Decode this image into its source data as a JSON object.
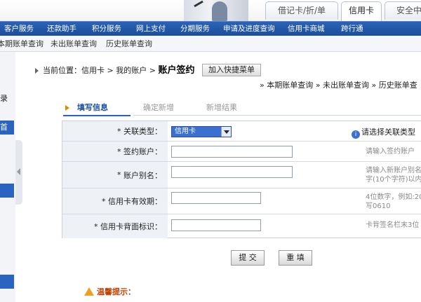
{
  "header": {
    "tabs": [
      "借记卡/折/单",
      "信用卡",
      "安全中"
    ]
  },
  "main_nav": [
    "客户服务",
    "还款助手",
    "积分服务",
    "网上支付",
    "分期服务",
    "申请及进度查询",
    "信用卡商城",
    "跨行通"
  ],
  "sub_nav": [
    "本期账单查询",
    "未出账单查询",
    "历史账单查询"
  ],
  "sidebar": {
    "items": [
      "录",
      "首"
    ]
  },
  "breadcrumb": {
    "prefix": "当前位置：",
    "path": [
      "信用卡",
      "我的账户"
    ],
    "current": "账户签约",
    "quick_button": "加入快捷菜单"
  },
  "bill_links": [
    "本期账单查询",
    "未出账单查询",
    "历史账单查"
  ],
  "steps": [
    "填写信息",
    "确定新增",
    "新增结果"
  ],
  "form": {
    "rows": [
      {
        "label": "关联类型：",
        "value": "信用卡",
        "hint": "请选择关联类型"
      },
      {
        "label": "签约账户：",
        "value": "",
        "hint": "请输入签约账户"
      },
      {
        "label": "账户别名：",
        "value": "",
        "hint": "请输入新账户别名",
        "hint2": "字(10个字符)以内"
      },
      {
        "label": "信用卡有效期：",
        "value": "",
        "hint": "4位数字，例如:20",
        "hint2": "写0610"
      },
      {
        "label": "信用卡背面标识：",
        "value": "",
        "hint": "卡背签名栏末3位"
      }
    ],
    "required_mark": "*"
  },
  "buttons": {
    "submit": "提 交",
    "reset": "重 填"
  },
  "warning": {
    "title": "温馨提示："
  }
}
